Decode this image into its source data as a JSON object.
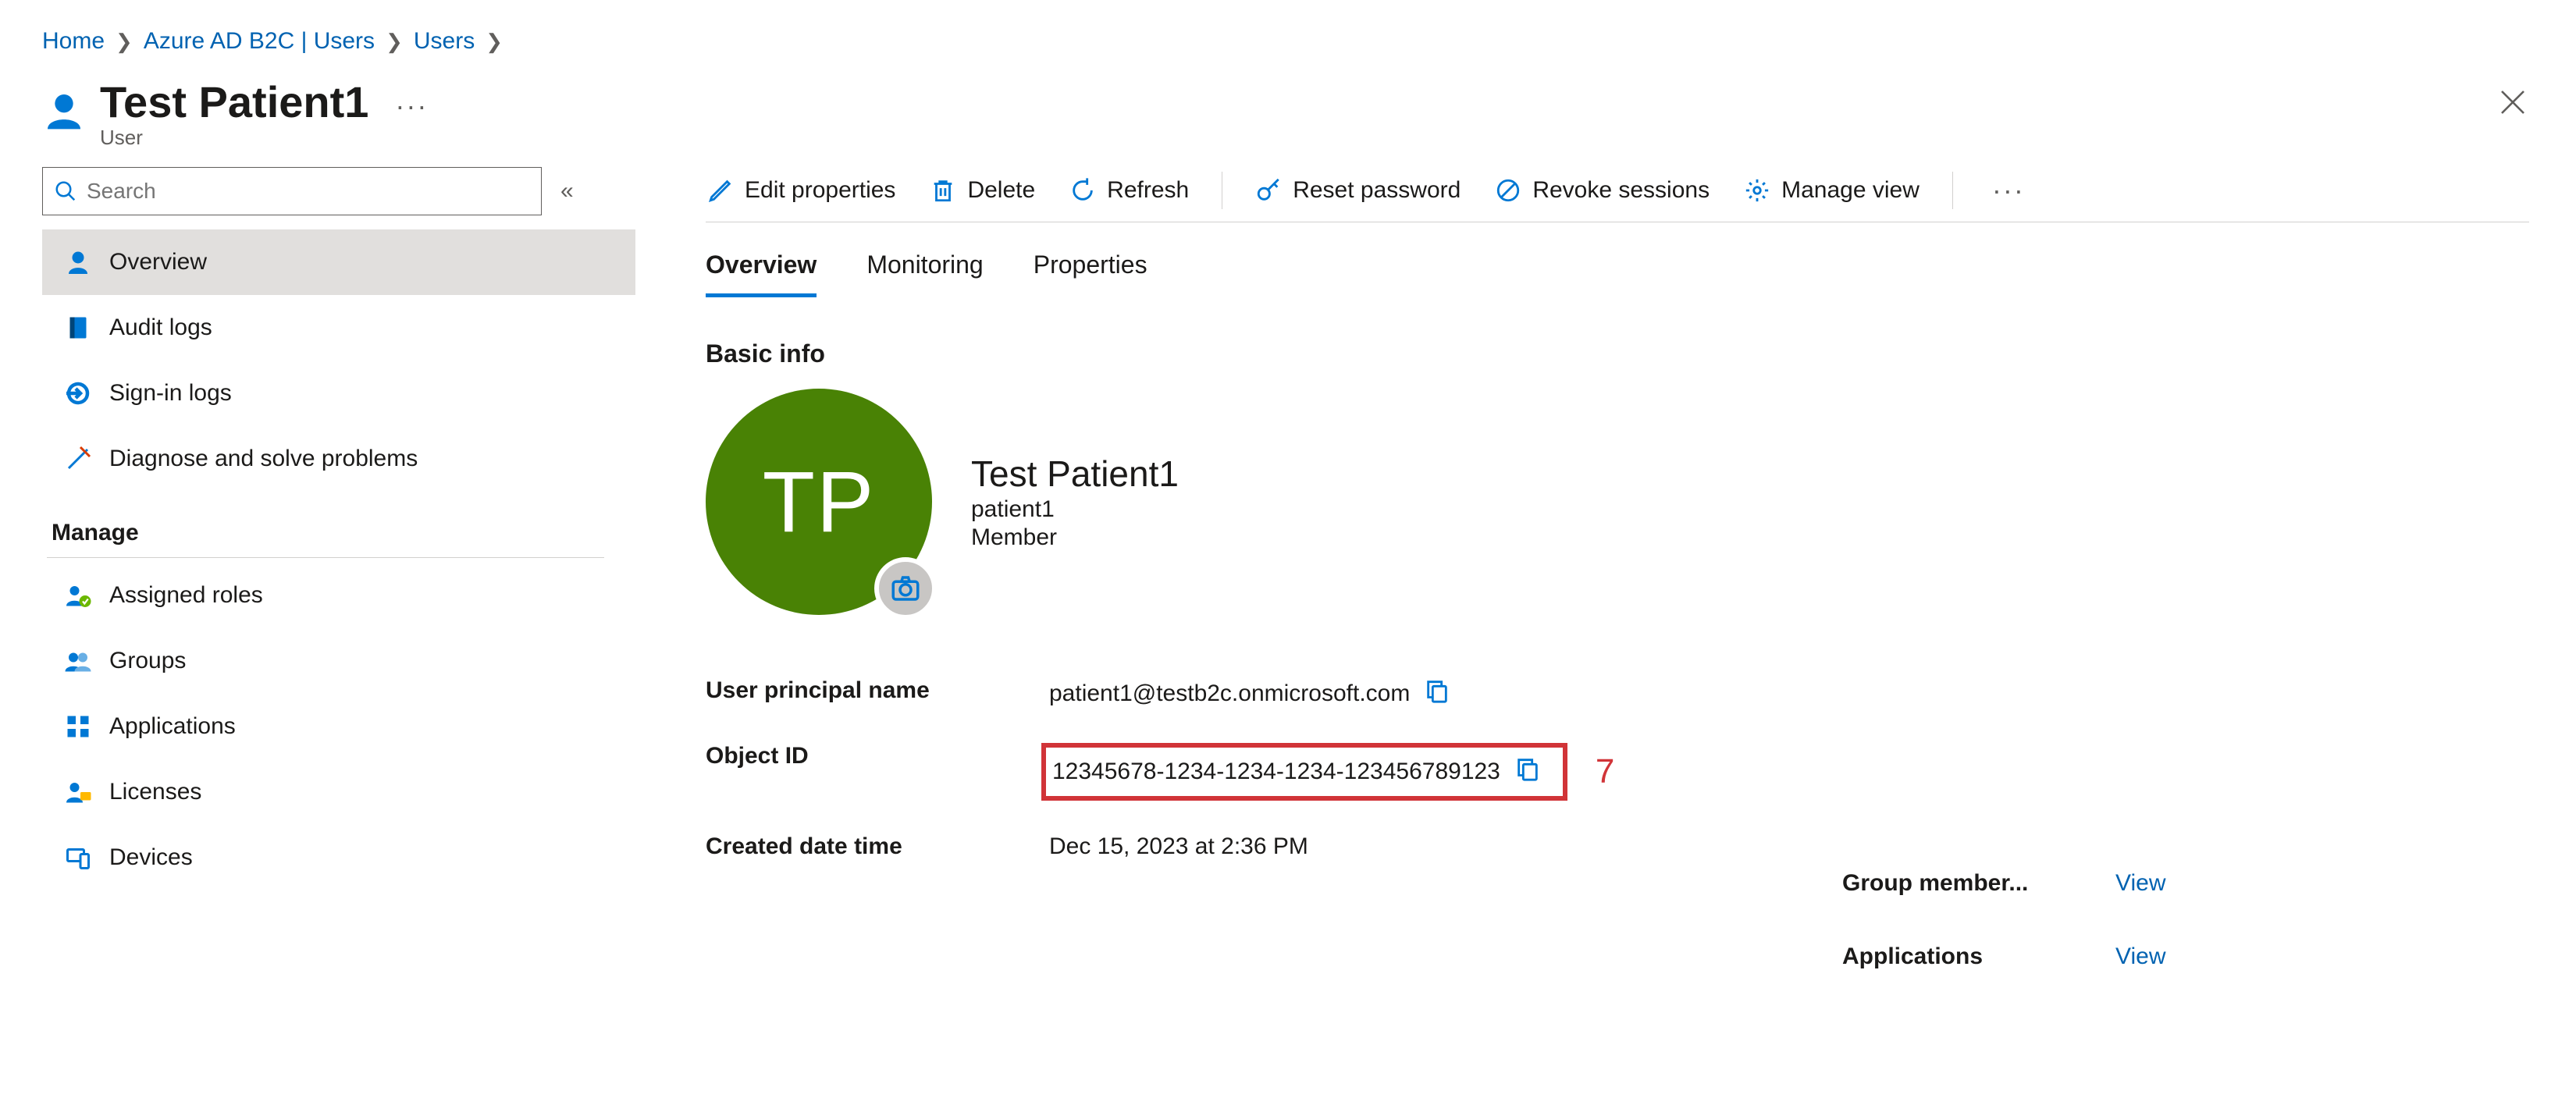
{
  "breadcrumb": {
    "items": [
      "Home",
      "Azure AD B2C | Users",
      "Users"
    ]
  },
  "header": {
    "title": "Test Patient1",
    "subtitle": "User"
  },
  "search": {
    "placeholder": "Search"
  },
  "sidebar": {
    "items": [
      {
        "label": "Overview",
        "icon": "user-icon",
        "selected": true
      },
      {
        "label": "Audit logs",
        "icon": "book-icon"
      },
      {
        "label": "Sign-in logs",
        "icon": "signin-icon"
      },
      {
        "label": "Diagnose and solve problems",
        "icon": "tools-icon"
      }
    ],
    "manage_heading": "Manage",
    "manage_items": [
      {
        "label": "Assigned roles",
        "icon": "user-role-icon"
      },
      {
        "label": "Groups",
        "icon": "groups-icon"
      },
      {
        "label": "Applications",
        "icon": "apps-icon"
      },
      {
        "label": "Licenses",
        "icon": "license-icon"
      },
      {
        "label": "Devices",
        "icon": "devices-icon"
      }
    ]
  },
  "toolbar": {
    "edit": "Edit properties",
    "delete": "Delete",
    "refresh": "Refresh",
    "reset_pw": "Reset password",
    "revoke": "Revoke sessions",
    "manage_view": "Manage view"
  },
  "tabs": {
    "overview": "Overview",
    "monitoring": "Monitoring",
    "properties": "Properties"
  },
  "basic_info": {
    "heading": "Basic info",
    "avatar_initials": "TP",
    "display_name": "Test Patient1",
    "username": "patient1",
    "user_type": "Member"
  },
  "properties": {
    "upn_label": "User principal name",
    "upn_value": "patient1@testb2c.onmicrosoft.com",
    "object_id_label": "Object ID",
    "object_id_value": "12345678-1234-1234-1234-123456789123",
    "created_label": "Created date time",
    "created_value": "Dec 15, 2023 at 2:36 PM"
  },
  "annotation": {
    "number": "7"
  },
  "right_summary": {
    "group_label": "Group member...",
    "apps_label": "Applications",
    "view": "View"
  }
}
